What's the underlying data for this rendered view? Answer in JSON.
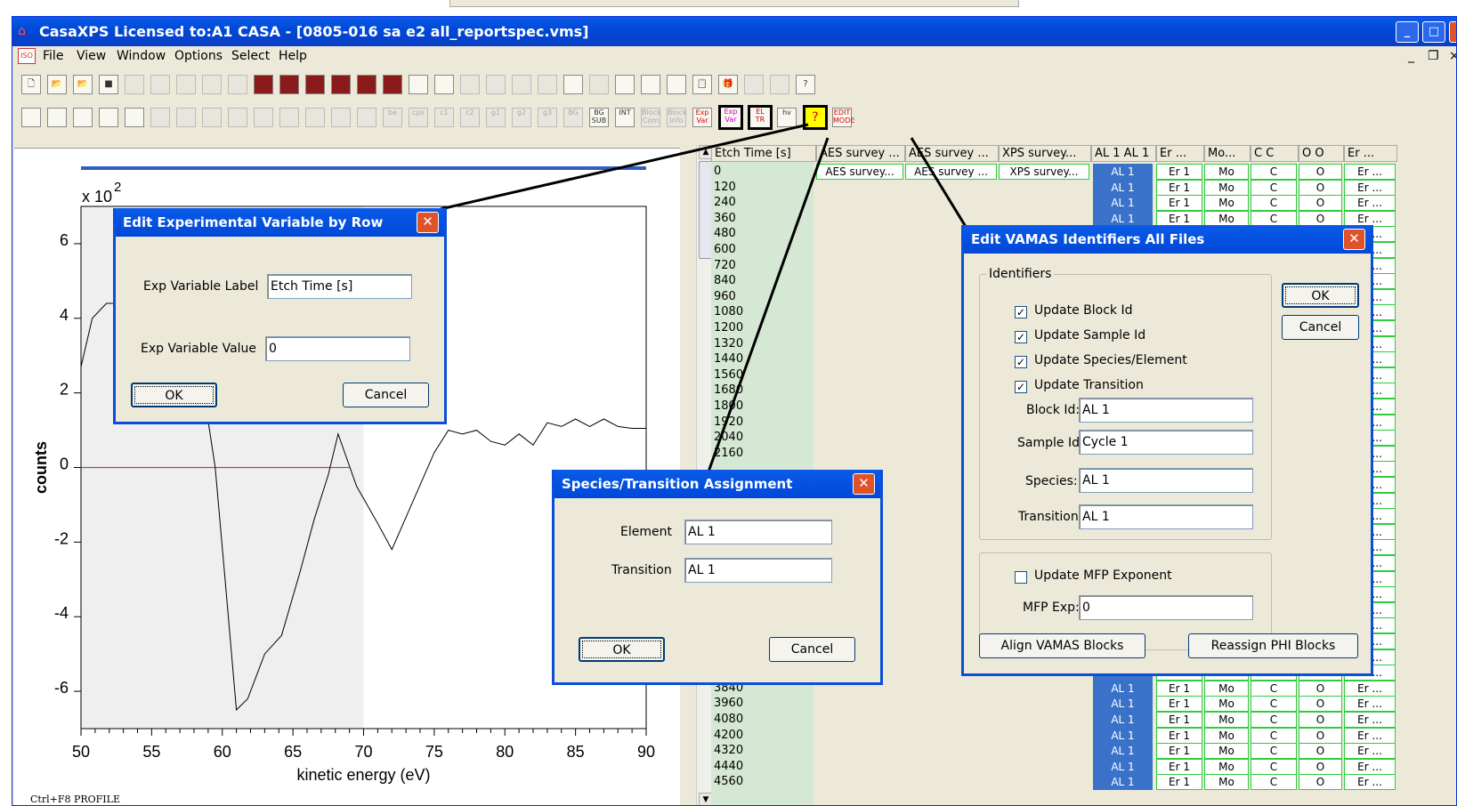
{
  "app": {
    "title": "CasaXPS Licensed to:A1 CASA - [0805-016 sa e2 all_reportspec.vms]"
  },
  "menu": [
    "File",
    "View",
    "Window",
    "Options",
    "Select",
    "Help"
  ],
  "mdi_controls": [
    "_",
    "❐",
    "×"
  ],
  "icons": {
    "app": "casa-house-icon",
    "close": "close-icon"
  },
  "colors": {
    "title": "#0048d8",
    "grid_blue": "#3a72c9",
    "grid_green": "#2ecc40",
    "col0": "#d5e8d4",
    "close": "#e0532a"
  },
  "toolbar1": [
    "new",
    "open",
    "open2",
    "save",
    "copy",
    "copy2",
    "copy3",
    "copy4",
    "a",
    "f1",
    "f2",
    "f3",
    "f4",
    "f5",
    "f6",
    "iso",
    "lib",
    "b1",
    "b2",
    "b3",
    "b4",
    "draw",
    "b5",
    "t1",
    "t2",
    "t3",
    "clip",
    "gift",
    "print",
    "preview",
    "help"
  ],
  "toolbar2": [
    "win1",
    "win2",
    "win3",
    "win4",
    "win5",
    "m1",
    "m2",
    "m3",
    "p1",
    "p2",
    "p3",
    "p4",
    "p5",
    "p6",
    "be",
    "cps",
    "c1",
    "c2",
    "g1",
    "g2",
    "g3",
    "BG",
    "BG SUB",
    "INT",
    "Block Com",
    "Block Info",
    "Exp Var",
    "Exp Var",
    "EL TR",
    "hv",
    "?",
    "EDIT MODE"
  ],
  "toolbar2_labels": {
    "bg": "BG",
    "bgsub": "BG SUB",
    "blockcom": "Block Com",
    "blockinfo": "Block Info",
    "expvar": "Exp Var",
    "eltr": "EL TR",
    "hv": "hv",
    "question": "?",
    "editmode": "EDIT MODE"
  },
  "chart_data": {
    "type": "line",
    "title": "",
    "xlabel": "kinetic energy (eV)",
    "ylabel": "counts",
    "y_multiplier": "x 10",
    "y_multiplier_exp": "2",
    "xlim": [
      50,
      90
    ],
    "ylim": [
      -7,
      7
    ],
    "xticks": [
      50,
      55,
      60,
      65,
      70,
      75,
      80,
      85,
      90
    ],
    "yticks": [
      6,
      4,
      2,
      0,
      -2,
      -4,
      -6
    ],
    "ytick_labels": [
      "6",
      "4",
      "2",
      "0",
      "-2",
      "-4",
      "-6"
    ],
    "shaded_region": [
      50,
      70
    ],
    "baseline_y": 0,
    "baseline_range": [
      50,
      69
    ],
    "x": [
      50,
      50.8,
      51.8,
      53,
      54.5,
      56,
      57.5,
      58.5,
      59.5,
      60.2,
      61,
      61.8,
      63,
      64.2,
      65.5,
      66.5,
      67.5,
      68.2,
      69.5,
      71,
      72,
      73.5,
      75,
      76,
      77,
      78,
      79,
      80,
      81,
      82,
      83,
      84,
      85,
      86,
      87,
      88,
      89,
      90
    ],
    "y": [
      2.7,
      4,
      4.4,
      4.4,
      4,
      3.5,
      3.2,
      2.5,
      0,
      -3,
      -6.5,
      -6.2,
      -5,
      -4.5,
      -2.8,
      -1.4,
      -0.2,
      0.9,
      -0.5,
      -1.5,
      -2.2,
      -0.9,
      0.4,
      1,
      0.9,
      1,
      0.7,
      0.6,
      0.9,
      0.6,
      1.2,
      1.1,
      1.3,
      1.1,
      1.3,
      1.1,
      1.05,
      1.05
    ]
  },
  "status": {
    "footer": "Ctrl+F8 PROFILE"
  },
  "grid": {
    "headers": [
      "Etch Time [s]",
      "AES survey ...",
      "AES survey ...",
      "XPS survey...",
      "AL 1 AL 1",
      "Er ...",
      "Mo...",
      "C C",
      "O O",
      "Er ..."
    ],
    "header_row": [
      "",
      "AES survey...",
      "AES survey ...",
      "XPS survey...",
      "AL 1",
      "Er 1",
      "Mo",
      "C",
      "O",
      "Er ..."
    ],
    "etch_times": [
      "0",
      "120",
      "240",
      "360",
      "480",
      "600",
      "720",
      "840",
      "960",
      "1080",
      "1200",
      "1320",
      "1440",
      "1560",
      "1680",
      "1800",
      "1920",
      "2040",
      "2160"
    ],
    "etch_times_bottom": [
      "3840",
      "3960",
      "4080",
      "4200",
      "4320",
      "4440",
      "4560"
    ],
    "row_cells": [
      "AL 1",
      "Er 1",
      "Mo",
      "C",
      "O",
      "Er ..."
    ]
  },
  "dlg_expvar": {
    "title": "Edit Experimental Variable by Row",
    "label_caption": "Exp Variable Label",
    "label_value": "Etch Time [s]",
    "value_caption": "Exp Variable Value",
    "value_value": "0",
    "ok": "OK",
    "cancel": "Cancel"
  },
  "dlg_species": {
    "title": "Species/Transition Assignment",
    "element_caption": "Element",
    "element_value": "AL 1",
    "transition_caption": "Transition",
    "transition_value": "AL 1",
    "ok": "OK",
    "cancel": "Cancel"
  },
  "dlg_vamas": {
    "title": "Edit VAMAS  Identifiers All Files",
    "group": "Identifiers",
    "cb_block": "Update Block Id",
    "cb_sample": "Update Sample Id",
    "cb_species": "Update Species/Element",
    "cb_transition": "Update Transition",
    "block_caption": "Block Id:",
    "block_value": "AL 1",
    "sample_caption": "Sample Id:",
    "sample_value": "Cycle 1",
    "species_caption": "Species:",
    "species_value": "AL 1",
    "transition_caption": "Transition:",
    "transition_value": "AL 1",
    "cb_mfp": "Update MFP Exponent",
    "mfp_caption": "MFP Exp:",
    "mfp_value": "0",
    "ok": "OK",
    "cancel": "Cancel",
    "align": "Align VAMAS Blocks",
    "reassign": "Reassign PHI Blocks"
  }
}
